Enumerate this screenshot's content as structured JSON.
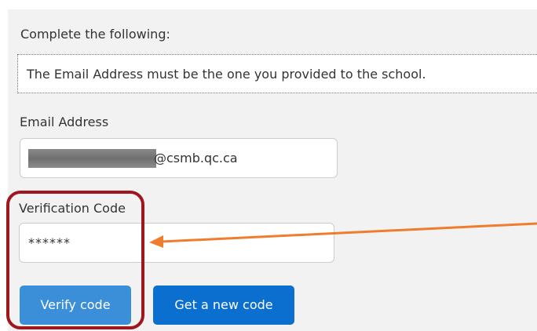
{
  "form": {
    "intro": "Complete the following:",
    "notice": "The Email Address must be the one you provided to the school.",
    "email": {
      "label": "Email Address",
      "visible_value": "@csmb.qc.ca"
    },
    "verification_code": {
      "label": "Verification Code",
      "value": "******"
    },
    "buttons": {
      "verify": "Verify code",
      "new_code": "Get a new code"
    }
  },
  "colors": {
    "panel_background": "#f2f2f2",
    "verify_button": "#3b8fd9",
    "new_code_button": "#0a6fcf",
    "annotation_box": "#a0161e",
    "annotation_arrow": "#ee7d2e"
  }
}
